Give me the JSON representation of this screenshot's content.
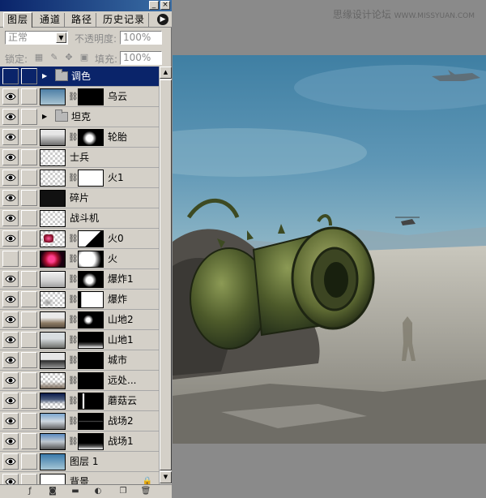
{
  "watermark": {
    "text": "思缘设计论坛",
    "url": "WWW.MISSYUAN.COM"
  },
  "panel": {
    "tabs": [
      {
        "label": "图层",
        "active": true
      },
      {
        "label": "通道",
        "active": false
      },
      {
        "label": "路径",
        "active": false
      },
      {
        "label": "历史记录",
        "active": false
      }
    ],
    "blend_mode": "正常",
    "opacity_label": "不透明度:",
    "opacity_value": "100%",
    "lock_label": "锁定:",
    "fill_label": "填充:",
    "fill_value": "100%"
  },
  "layers": [
    {
      "name": "调色",
      "type": "folder",
      "selected": true,
      "visible": false,
      "expanded": false
    },
    {
      "name": "乌云",
      "type": "layer",
      "thumb": "sky",
      "mask": "black",
      "visible": true
    },
    {
      "name": "坦克",
      "type": "folder",
      "visible": true,
      "expanded": false
    },
    {
      "name": "轮胎",
      "type": "layer",
      "thumb": "tire",
      "mask": "black-white-blob",
      "visible": true
    },
    {
      "name": "士兵",
      "type": "layer",
      "thumb": "checker",
      "visible": true
    },
    {
      "name": "火1",
      "type": "layer",
      "thumb": "checker",
      "mask": "white",
      "visible": true
    },
    {
      "name": "碎片",
      "type": "layer",
      "thumb": "debris",
      "visible": true
    },
    {
      "name": "战斗机",
      "type": "layer",
      "thumb": "checker",
      "visible": true
    },
    {
      "name": "火0",
      "type": "layer",
      "thumb": "checker-red",
      "mask": "white-black-corner",
      "visible": true
    },
    {
      "name": "火",
      "type": "layer",
      "thumb": "fire",
      "mask": "white-glow",
      "visible": false
    },
    {
      "name": "爆炸1",
      "type": "layer",
      "thumb": "smoke",
      "mask": "black-white-blob",
      "visible": true
    },
    {
      "name": "爆炸",
      "type": "layer",
      "thumb": "checker-smoke",
      "mask": "white-left",
      "visible": true
    },
    {
      "name": "山地2",
      "type": "layer",
      "thumb": "mountain",
      "mask": "black-white-dot",
      "visible": true
    },
    {
      "name": "山地1",
      "type": "layer",
      "thumb": "mountain2",
      "mask": "black-white-bottom",
      "visible": true
    },
    {
      "name": "城市",
      "type": "layer",
      "thumb": "city",
      "mask": "black",
      "visible": true
    },
    {
      "name": "远处...",
      "type": "layer",
      "thumb": "checker-far",
      "mask": "black",
      "visible": true
    },
    {
      "name": "蘑菇云",
      "type": "layer",
      "thumb": "checker-cloud",
      "mask": "black-white-left",
      "visible": true
    },
    {
      "name": "战场2",
      "type": "layer",
      "thumb": "battle",
      "mask": "black-line",
      "visible": true
    },
    {
      "name": "战场1",
      "type": "layer",
      "thumb": "battle2",
      "mask": "black-white-bottom",
      "visible": true
    },
    {
      "name": "图层 1",
      "type": "layer",
      "thumb": "skyblue",
      "visible": true
    },
    {
      "name": "背景",
      "type": "layer",
      "thumb": "white",
      "visible": true,
      "locked": true
    }
  ]
}
